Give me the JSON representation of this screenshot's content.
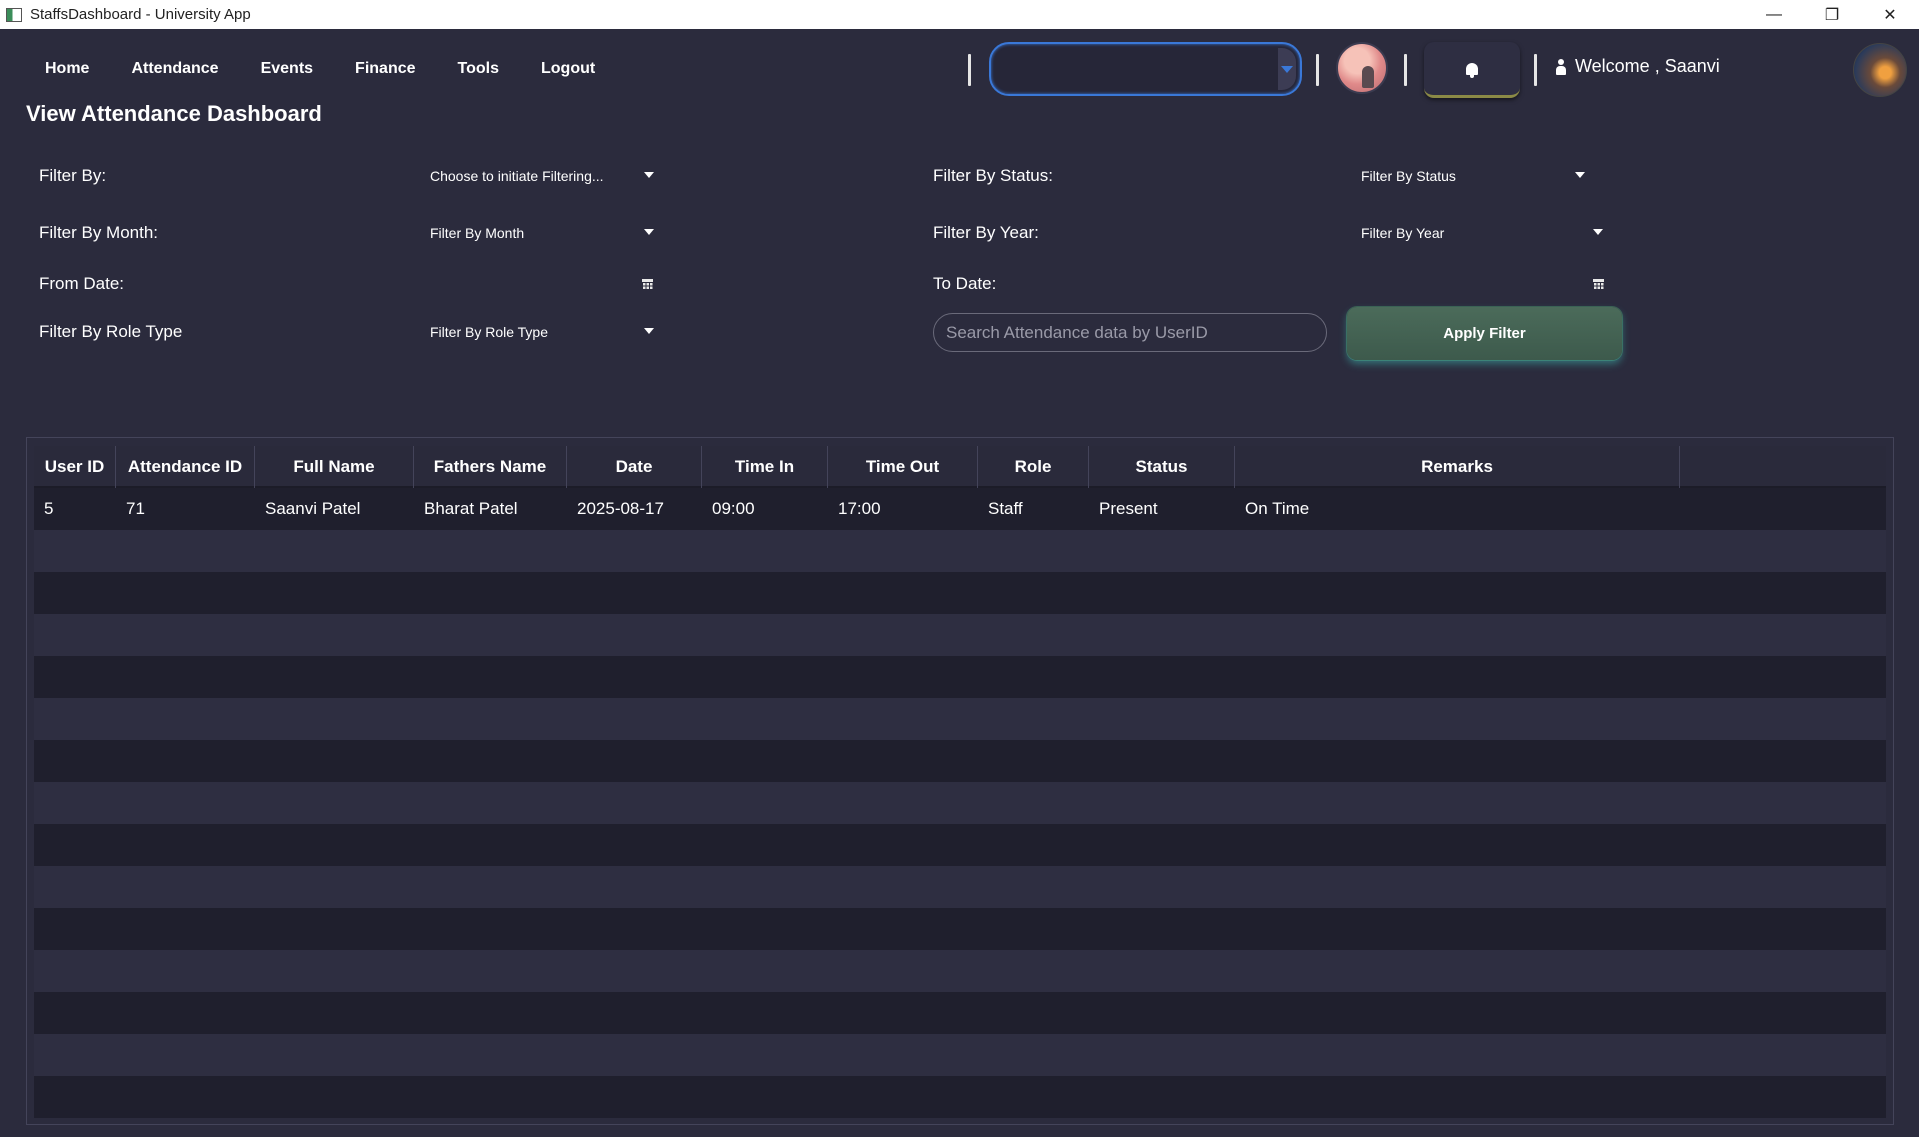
{
  "window": {
    "title": "StaffsDashboard - University App",
    "minimize": "—",
    "restore": "❐",
    "close": "✕"
  },
  "nav": {
    "links": [
      "Home",
      "Attendance",
      "Events",
      "Finance",
      "Tools",
      "Logout"
    ],
    "welcome": "Welcome , Saanvi",
    "combo_value": ""
  },
  "page": {
    "title": "View Attendance Dashboard"
  },
  "filters": {
    "filter_by_label": "Filter By:",
    "filter_by_value": "Choose to initiate Filtering...",
    "status_label": "Filter By Status:",
    "status_value": "Filter By Status",
    "month_label": "Filter By Month:",
    "month_value": "Filter By Month",
    "year_label": "Filter By Year:",
    "year_value": "Filter By Year",
    "from_label": "From Date:",
    "to_label": "To Date:",
    "role_label": "Filter By Role Type",
    "role_value": "Filter By Role Type",
    "search_placeholder": "Search Attendance data by UserID",
    "apply_label": "Apply Filter"
  },
  "table": {
    "columns": [
      "User ID",
      "Attendance ID",
      "Full Name",
      "Fathers Name",
      "Date",
      "Time In",
      "Time Out",
      "Role",
      "Status",
      "Remarks"
    ],
    "rows": [
      [
        "5",
        "71",
        "Saanvi Patel",
        "Bharat Patel",
        "2025-08-17",
        "09:00",
        "17:00",
        "Staff",
        "Present",
        "On Time"
      ]
    ]
  }
}
